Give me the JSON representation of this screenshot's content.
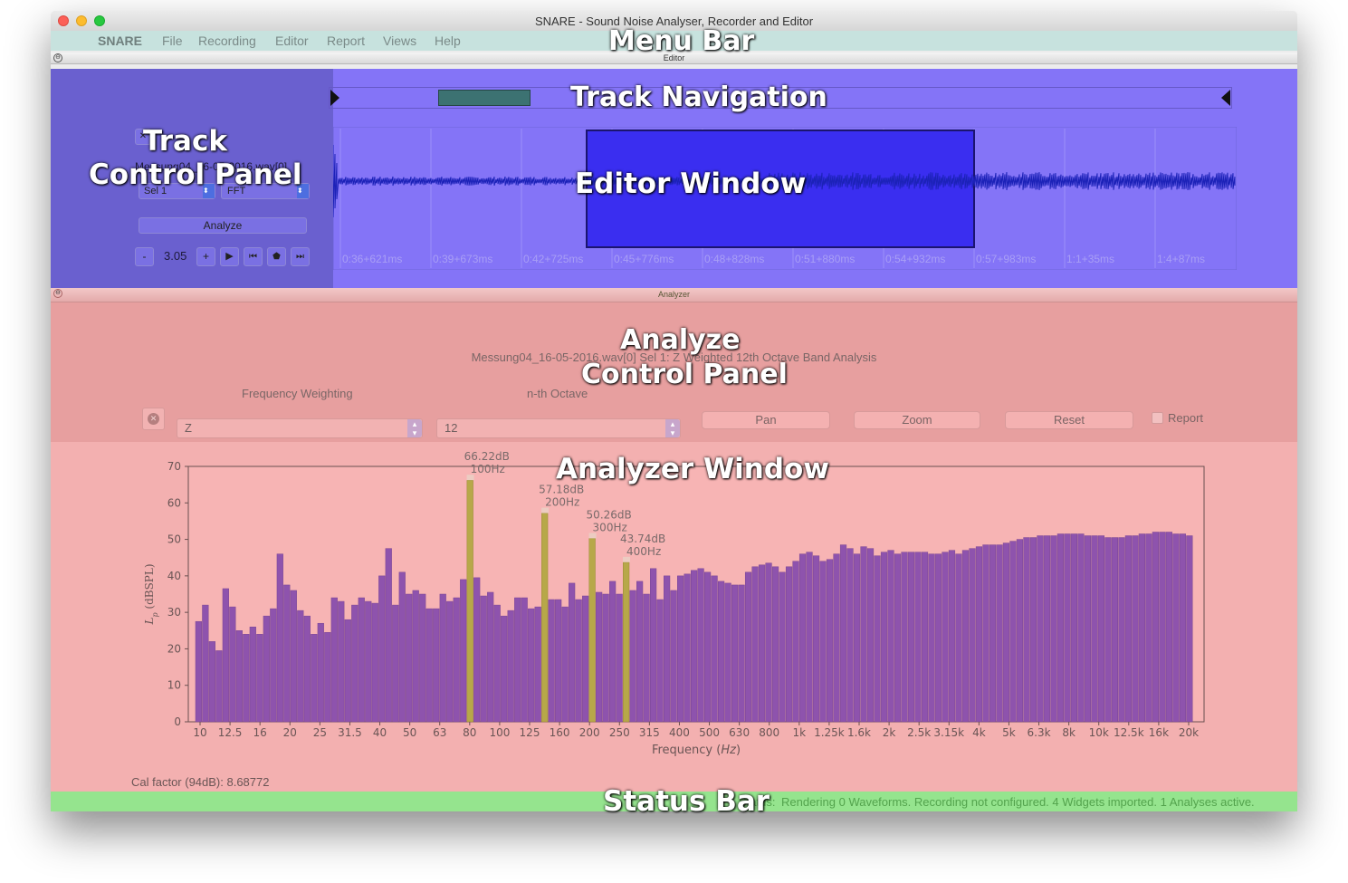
{
  "window": {
    "title": "SNARE - Sound Noise Analyser, Recorder and Editor"
  },
  "menu": {
    "app": "SNARE",
    "items": [
      "File",
      "Recording",
      "Editor",
      "Report",
      "Views",
      "Help"
    ]
  },
  "editor_dock_title": "Editor",
  "analyzer_dock_title": "Analyzer",
  "labels": {
    "menu_bar": "Menu Bar",
    "track_navigation": "Track Navigation",
    "track_control_1": "Track",
    "track_control_2": "Control Panel",
    "editor_window": "Editor Window",
    "analyze_control_1": "Analyze",
    "analyze_control_2": "Control Panel",
    "analyzer_window": "Analyzer Window",
    "status_bar": "Status Bar"
  },
  "track_control": {
    "track_name": "Messung04_16-05-2016.wav[0]",
    "selection": "Sel 1",
    "method": "FFT",
    "analyze_label": "Analyze",
    "minus_label": "-",
    "plus_label": "+",
    "zoom_value": "3.05"
  },
  "timeline_labels": [
    "0:36+621ms",
    "0:39+673ms",
    "0:42+725ms",
    "0:45+776ms",
    "0:48+828ms",
    "0:51+880ms",
    "0:54+932ms",
    "0:57+983ms",
    "1:1+35ms",
    "1:4+87ms"
  ],
  "analyze_control": {
    "analysis_title": "Messung04_16-05-2016.wav[0] Sel 1: Z Weighted 12th Octave Band Analysis",
    "freq_weighting_label": "Frequency Weighting",
    "freq_weighting_value": "Z",
    "octave_label": "n-th Octave",
    "octave_value": "12",
    "pan_label": "Pan",
    "zoom_label": "Zoom",
    "reset_label": "Reset",
    "report_label": "Report"
  },
  "cal_factor": "Cal factor (94dB): 8.68772",
  "status": {
    "prefix": "Status:",
    "text": "Rendering 0 Waveforms.  Recording not configured.  4 Widgets imported.  1 Analyses active."
  },
  "colors": {
    "bar": "#8e53ad",
    "bar_highlight": "#b7a849",
    "editor_bg": "#8474f7",
    "selection": "#3a2ef0",
    "analyzer_bg": "#f3b0b0",
    "status_bg": "#95e48e"
  },
  "chart_data": {
    "type": "bar",
    "title": "",
    "xlabel": "Frequency (Hz)",
    "ylabel": "Lp (dBSPL)",
    "ylim": [
      0,
      70
    ],
    "yticks": [
      0,
      10,
      20,
      30,
      40,
      50,
      60,
      70
    ],
    "xtick_labels": [
      "10",
      "12.5",
      "16",
      "20",
      "25",
      "31.5",
      "40",
      "50",
      "63",
      "80",
      "100",
      "125",
      "160",
      "200",
      "250",
      "315",
      "400",
      "500",
      "630",
      "800",
      "1k",
      "1.25k",
      "1.6k",
      "2k",
      "2.5k",
      "3.15k",
      "4k",
      "5k",
      "6.3k",
      "8k",
      "10k",
      "12.5k",
      "16k",
      "20k"
    ],
    "values": [
      27.5,
      32,
      22,
      19.5,
      36.5,
      31.5,
      25,
      24,
      26,
      24,
      29,
      31,
      46,
      37.5,
      36,
      30.5,
      29,
      24,
      27,
      24.5,
      34,
      33,
      28,
      32,
      34,
      33,
      32.5,
      40,
      47.5,
      32,
      41,
      35,
      36,
      35,
      31,
      31,
      35,
      33,
      34,
      39,
      66.2,
      39.5,
      34.5,
      35.5,
      32,
      29,
      30.5,
      34,
      34,
      31,
      31.5,
      57.2,
      33.5,
      33.5,
      31.5,
      38,
      33.5,
      34.5,
      50.3,
      35.5,
      35,
      38.5,
      35,
      43.7,
      36,
      38.5,
      35,
      42,
      33.5,
      40,
      36,
      40,
      40.5,
      41.5,
      42,
      41,
      40,
      38.5,
      38,
      37.5,
      37.5,
      41,
      42.5,
      43,
      43.5,
      42.5,
      41,
      42.5,
      44,
      46,
      46.5,
      45.5,
      44,
      44.5,
      46,
      48.5,
      47.5,
      46,
      48,
      47.5,
      45.5,
      46.5,
      47,
      46,
      46.5,
      46.5,
      46.5,
      46.5,
      46,
      46,
      46.5,
      47,
      46,
      47,
      47.5,
      48,
      48.5,
      48.5,
      48.5,
      49,
      49.5,
      50,
      50.5,
      50.5,
      51,
      51,
      51,
      51.5,
      51.5,
      51.5,
      51.5,
      51,
      51,
      51,
      50.5,
      50.5,
      50.5,
      51,
      51,
      51.5,
      51.5,
      52,
      52,
      52,
      51.5,
      51.5,
      51
    ],
    "highlighted": [
      {
        "index": 40,
        "value": 66.22,
        "db_label": "66.22dB",
        "freq_label": "100Hz"
      },
      {
        "index": 51,
        "value": 57.18,
        "db_label": "57.18dB",
        "freq_label": "200Hz"
      },
      {
        "index": 58,
        "value": 50.26,
        "db_label": "50.26dB",
        "freq_label": "300Hz"
      },
      {
        "index": 63,
        "value": 43.74,
        "db_label": "43.74dB",
        "freq_label": "400Hz"
      }
    ]
  }
}
